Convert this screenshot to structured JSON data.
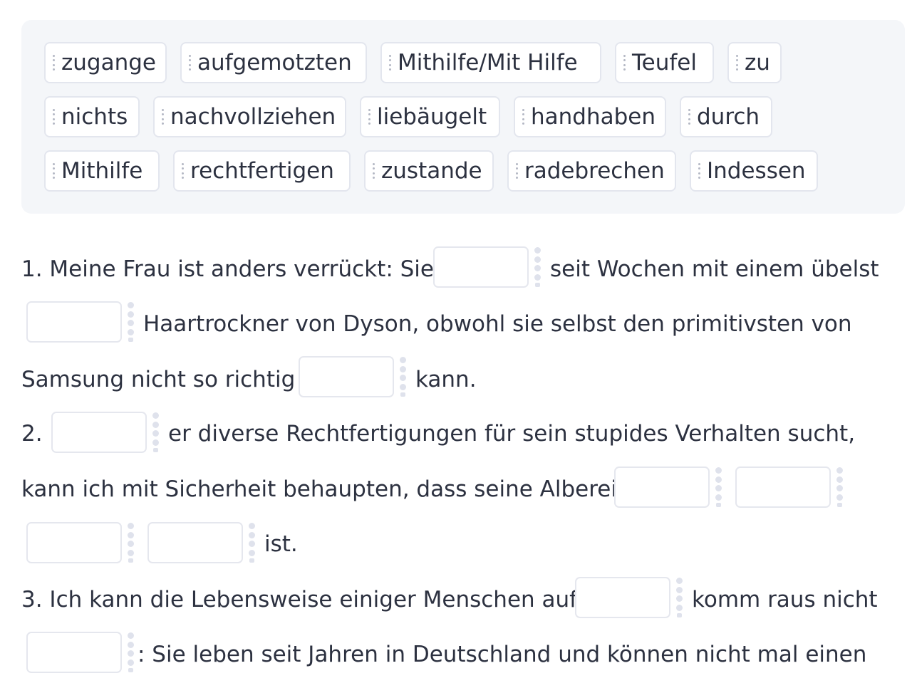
{
  "word_bank": [
    "zugange",
    "aufgemotzten",
    "Mithilfe/Mit Hilfe",
    "Teufel",
    "zu",
    "nichts",
    "nachvollziehen",
    "liebäugelt",
    "handhaben",
    "durch",
    "Mithilfe",
    "rechtfertigen",
    "zustande",
    "radebrechen",
    "Indessen"
  ],
  "exercise": {
    "s1": {
      "a": "1. Meine Frau ist anders verrückt: Sie",
      "b": "seit Wochen mit einem übelst",
      "c": "Haartrockner von Dyson, obwohl sie selbst den primitivsten von",
      "d": "Samsung nicht so richtig",
      "e": "kann."
    },
    "s2": {
      "a": "2.",
      "b": "er diverse Rechtfertigungen für sein stupides Verhalten sucht,",
      "c": "kann ich mit Sicherheit behaupten, dass seine Alberei",
      "d": "ist."
    },
    "s3": {
      "a": "3. Ich kann die Lebensweise einiger Menschen auf",
      "b": "komm raus nicht",
      "c": ": Sie leben seit Jahren in Deutschland und können nicht mal einen"
    }
  }
}
